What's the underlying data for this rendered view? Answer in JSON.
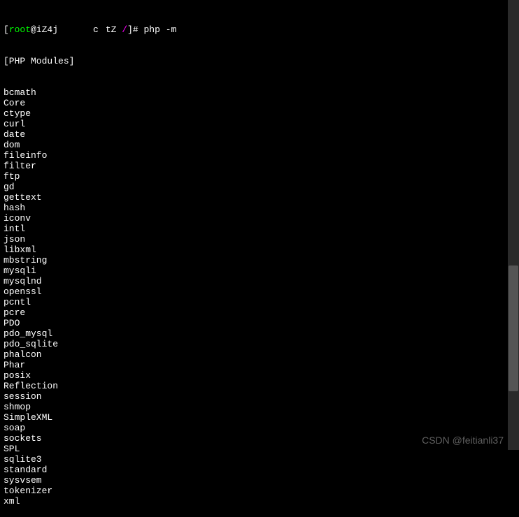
{
  "prompt": {
    "open_bracket": "[",
    "user": "root",
    "at": "@iZ4j",
    "redacted": "      ",
    "host_mid": "c",
    "host_suffix": "tZ ",
    "path": "/",
    "close_bracket": "]",
    "symbol": "# ",
    "command": "php -m"
  },
  "header": "[PHP Modules]",
  "modules": [
    "bcmath",
    "Core",
    "ctype",
    "curl",
    "date",
    "dom",
    "fileinfo",
    "filter",
    "ftp",
    "gd",
    "gettext",
    "hash",
    "iconv",
    "intl",
    "json",
    "libxml",
    "mbstring",
    "mysqli",
    "mysqlnd",
    "openssl",
    "pcntl",
    "pcre",
    "PDO",
    "pdo_mysql",
    "pdo_sqlite",
    "phalcon",
    "Phar",
    "posix",
    "Reflection",
    "session",
    "shmop",
    "SimpleXML",
    "soap",
    "sockets",
    "SPL",
    "sqlite3",
    "standard",
    "sysvsem",
    "tokenizer",
    "xml"
  ],
  "watermark": "CSDN @feitianli37"
}
